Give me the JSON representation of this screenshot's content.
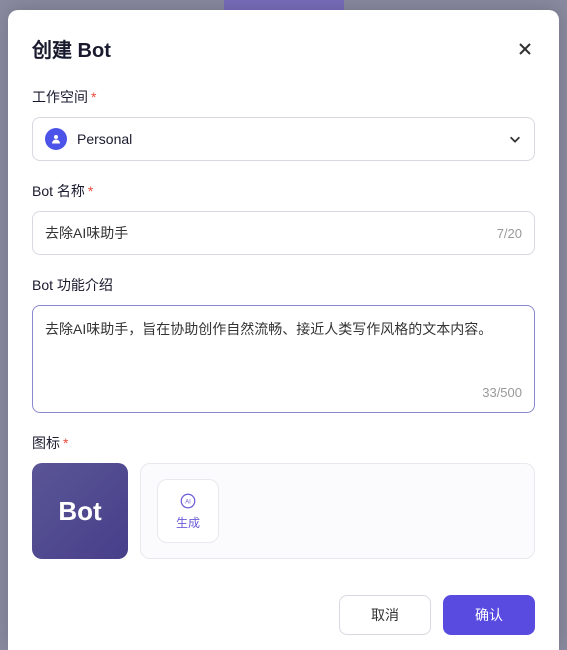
{
  "modal": {
    "title": "创建 Bot"
  },
  "workspace": {
    "label": "工作空间",
    "value": "Personal"
  },
  "botName": {
    "label": "Bot 名称",
    "value": "去除AI味助手",
    "count": "7/20"
  },
  "botDesc": {
    "label": "Bot 功能介绍",
    "value": "去除AI味助手，旨在协助创作自然流畅、接近人类写作风格的文本内容。",
    "count": "33/500"
  },
  "botIcon": {
    "label": "图标",
    "previewText": "Bot",
    "genLabel": "生成"
  },
  "footer": {
    "cancel": "取消",
    "confirm": "确认"
  }
}
